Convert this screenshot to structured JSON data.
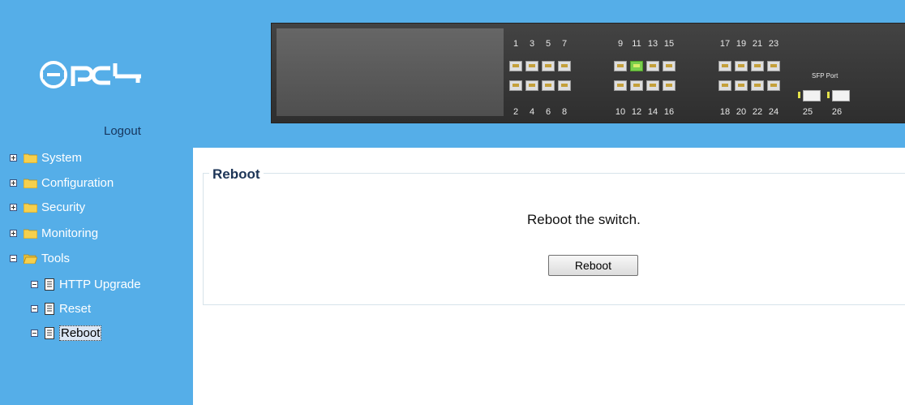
{
  "sidebar": {
    "logout_label": "Logout",
    "items": [
      {
        "label": "System",
        "expander": "plus",
        "icon": "folder-closed-icon"
      },
      {
        "label": "Configuration",
        "expander": "plus",
        "icon": "folder-closed-icon"
      },
      {
        "label": "Security",
        "expander": "plus",
        "icon": "folder-closed-icon"
      },
      {
        "label": "Monitoring",
        "expander": "plus",
        "icon": "folder-closed-icon"
      },
      {
        "label": "Tools",
        "expander": "minus",
        "icon": "folder-open-icon"
      }
    ],
    "tools_children": [
      {
        "label": "HTTP Upgrade",
        "icon": "page-icon"
      },
      {
        "label": "Reset",
        "icon": "page-icon"
      },
      {
        "label": "Reboot",
        "icon": "page-icon",
        "selected": true
      }
    ]
  },
  "panel": {
    "top_port_numbers": [
      "1",
      "3",
      "5",
      "7",
      "9",
      "11",
      "13",
      "15",
      "17",
      "19",
      "21",
      "23"
    ],
    "bottom_port_numbers": [
      "2",
      "4",
      "6",
      "8",
      "10",
      "12",
      "14",
      "16",
      "18",
      "20",
      "22",
      "24"
    ],
    "sfp_label": "SFP Port",
    "sfp_port_numbers": [
      "25",
      "26"
    ],
    "active_port": "11"
  },
  "content": {
    "legend": "Reboot",
    "message": "Reboot the switch.",
    "button_label": "Reboot"
  },
  "colors": {
    "sidebar_bg": "#55aee8",
    "logout_text": "#17365d",
    "legend_text": "#1d3557"
  }
}
